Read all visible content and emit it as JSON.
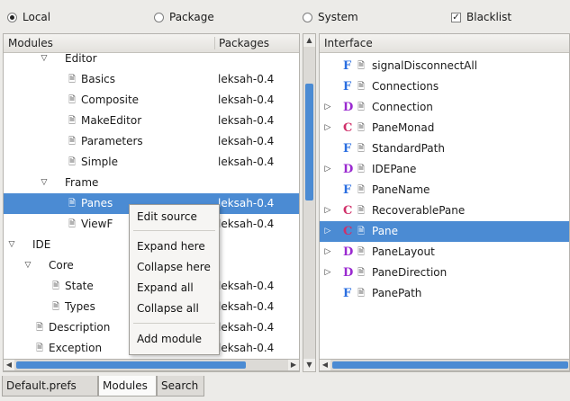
{
  "scope": {
    "options": [
      {
        "label": "Local",
        "selected": true
      },
      {
        "label": "Package",
        "selected": false
      },
      {
        "label": "System",
        "selected": false
      }
    ],
    "blacklist": {
      "label": "Blacklist",
      "checked": true
    }
  },
  "modules_pane": {
    "columns": {
      "modules": "Modules",
      "packages": "Packages"
    },
    "rows": [
      {
        "name": "Editor",
        "package": "",
        "expander": "▽",
        "leaf": false
      },
      {
        "name": "Basics",
        "package": "leksah-0.4",
        "expander": "",
        "leaf": true
      },
      {
        "name": "Composite",
        "package": "leksah-0.4",
        "expander": "",
        "leaf": true
      },
      {
        "name": "MakeEditor",
        "package": "leksah-0.4",
        "expander": "",
        "leaf": true
      },
      {
        "name": "Parameters",
        "package": "leksah-0.4",
        "expander": "",
        "leaf": true
      },
      {
        "name": "Simple",
        "package": "leksah-0.4",
        "expander": "",
        "leaf": true
      },
      {
        "name": "Frame",
        "package": "",
        "expander": "▽",
        "leaf": false
      },
      {
        "name": "Panes",
        "package": "leksah-0.4",
        "expander": "",
        "leaf": true,
        "selected": true
      },
      {
        "name": "ViewF",
        "package": "leksah-0.4",
        "expander": "",
        "leaf": true
      },
      {
        "name": "IDE",
        "package": "",
        "expander": "▽",
        "leaf": false
      },
      {
        "name": "Core",
        "package": "",
        "expander": "▽",
        "leaf": false
      },
      {
        "name": "State",
        "package": "leksah-0.4",
        "expander": "",
        "leaf": true
      },
      {
        "name": "Types",
        "package": "leksah-0.4",
        "expander": "",
        "leaf": true
      },
      {
        "name": "Description",
        "package": "leksah-0.4",
        "expander": "",
        "leaf": true
      },
      {
        "name": "Exception",
        "package": "leksah-0.4",
        "expander": "",
        "leaf": true
      }
    ]
  },
  "interface_pane": {
    "column": "Interface",
    "rows": [
      {
        "kind": "F",
        "name": "signalDisconnectAll",
        "expandable": false
      },
      {
        "kind": "F",
        "name": "Connections",
        "expandable": false
      },
      {
        "kind": "D",
        "name": "Connection",
        "expandable": true
      },
      {
        "kind": "C",
        "name": "PaneMonad",
        "expandable": true
      },
      {
        "kind": "F",
        "name": "StandardPath",
        "expandable": false
      },
      {
        "kind": "D",
        "name": "IDEPane",
        "expandable": true
      },
      {
        "kind": "F",
        "name": "PaneName",
        "expandable": false
      },
      {
        "kind": "C",
        "name": "RecoverablePane",
        "expandable": true
      },
      {
        "kind": "C",
        "name": "Pane",
        "expandable": true,
        "selected": true
      },
      {
        "kind": "D",
        "name": "PaneLayout",
        "expandable": true
      },
      {
        "kind": "D",
        "name": "PaneDirection",
        "expandable": true
      },
      {
        "kind": "F",
        "name": "PanePath",
        "expandable": false
      }
    ]
  },
  "context_menu": {
    "items": [
      "Edit source",
      "Expand here",
      "Collapse here",
      "Expand all",
      "Collapse all",
      "Add module"
    ]
  },
  "tabs": [
    {
      "label": "Default.prefs",
      "active": false
    },
    {
      "label": "Modules",
      "active": true
    },
    {
      "label": "Search",
      "active": false
    }
  ],
  "colors": {
    "selection": "#4b8bd3",
    "kind_F": "#2a6ee0",
    "kind_D": "#9a2ad0",
    "kind_C": "#d0306a"
  }
}
